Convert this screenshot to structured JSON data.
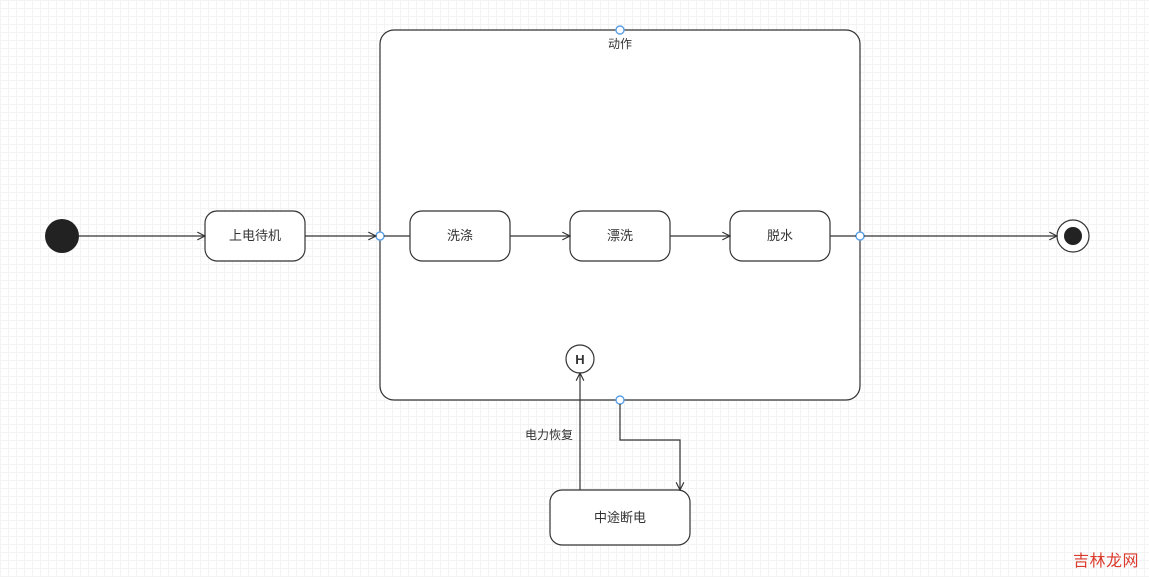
{
  "diagram": {
    "watermark": "吉林龙网",
    "container_title": "动作",
    "nodes": {
      "start": {
        "type": "initial"
      },
      "standby": {
        "label": "上电待机"
      },
      "wash": {
        "label": "洗涤"
      },
      "rinse": {
        "label": "漂洗"
      },
      "spin": {
        "label": "脱水"
      },
      "history": {
        "type": "history",
        "label": "H"
      },
      "power_cut": {
        "label": "中途断电"
      },
      "end": {
        "type": "final"
      }
    },
    "edges": {
      "resume_label": "电力恢复"
    }
  }
}
